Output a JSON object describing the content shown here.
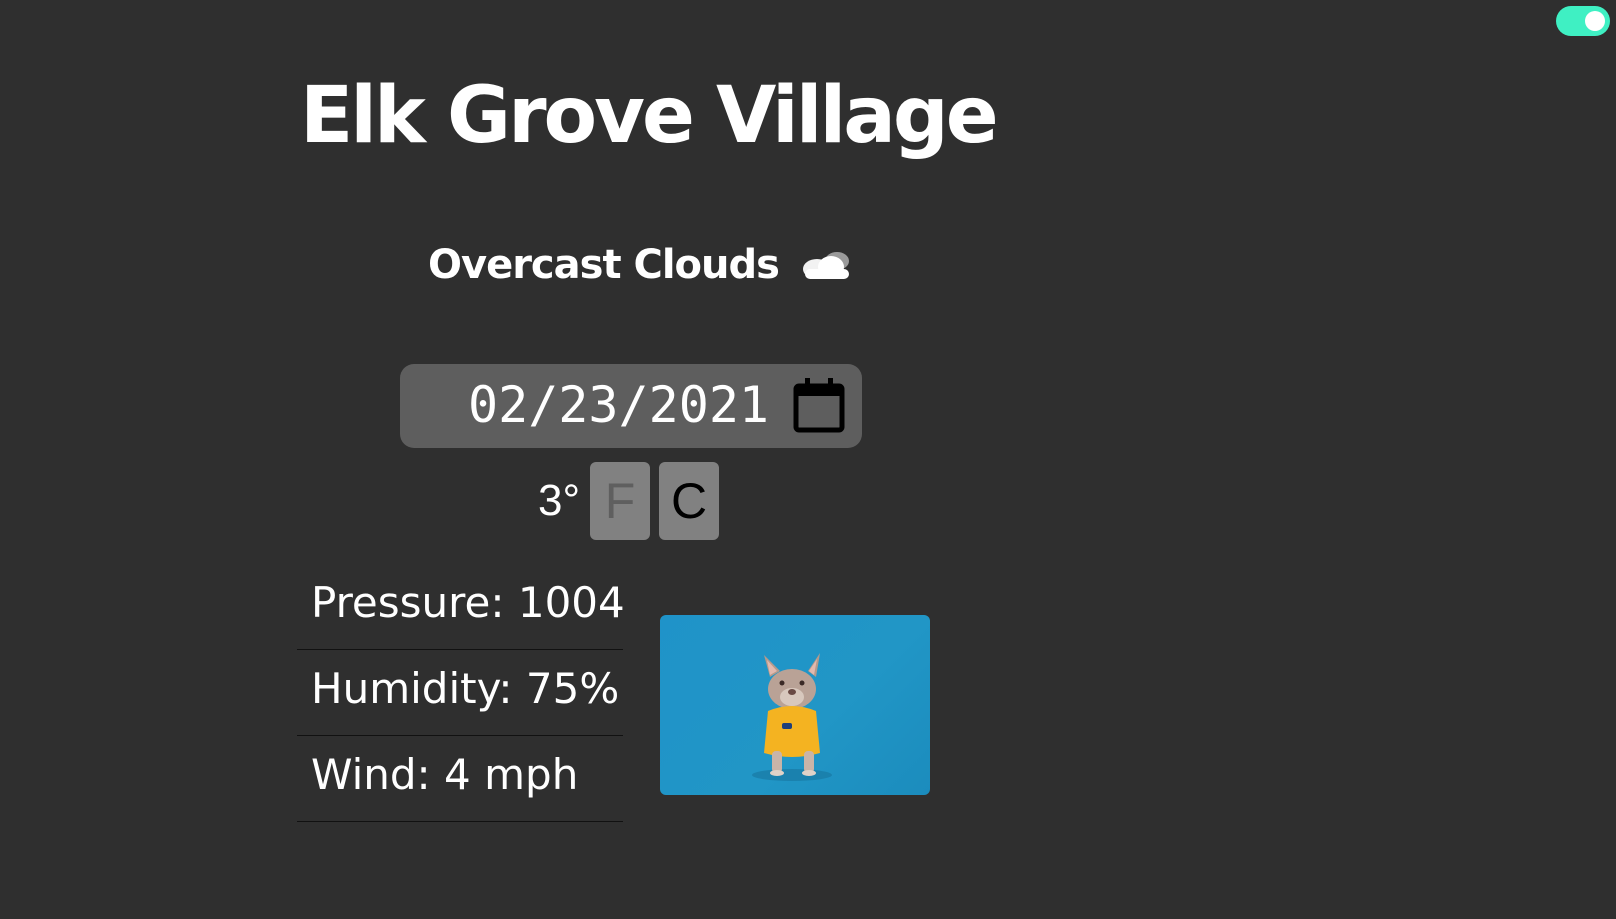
{
  "city": "Elk Grove Village",
  "conditions": {
    "description": "Overcast Clouds",
    "icon": "cloud-icon"
  },
  "date_input": {
    "value": "02/23/2021",
    "icon": "calendar-icon"
  },
  "temperature": {
    "value": "3°",
    "unit_f_label": "F",
    "unit_c_label": "C",
    "selected_unit": "C"
  },
  "stats": [
    {
      "text": "Pressure: 1004"
    },
    {
      "text": "Humidity: 75%"
    },
    {
      "text": "Wind: 4 mph"
    }
  ],
  "theme_toggle": {
    "state": "on",
    "accent_color": "#3ff0c3"
  },
  "colors": {
    "background": "#2f2f2f",
    "date_field": "#5e5e5e",
    "unit_button": "#818181"
  }
}
